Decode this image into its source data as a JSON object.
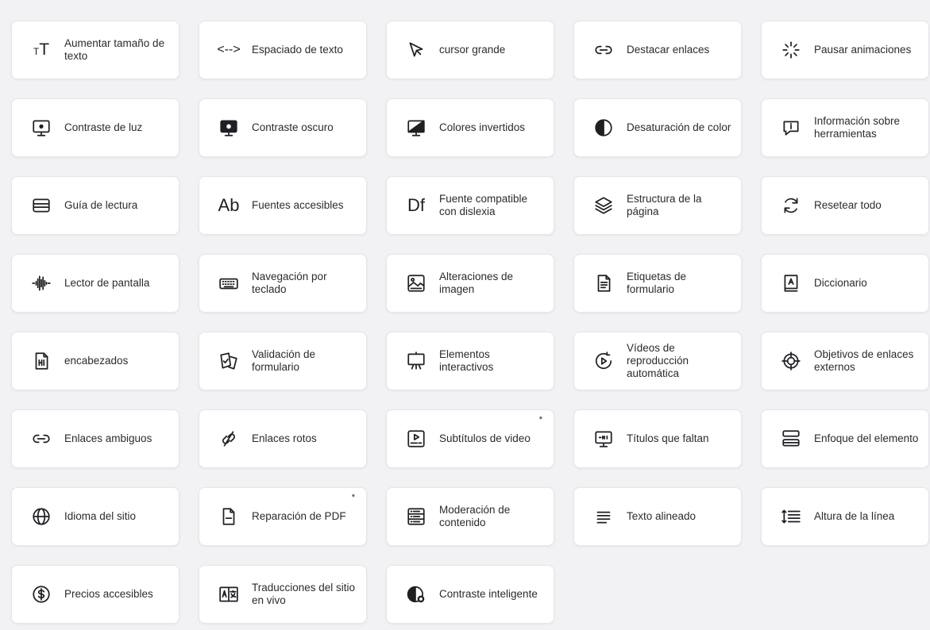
{
  "tools": [
    {
      "label": "Aumentar tamaño de texto",
      "icon": "text-size-icon",
      "glyph": "TT"
    },
    {
      "label": "Espaciado de texto",
      "icon": "text-spacing-icon",
      "glyph": "<-->"
    },
    {
      "label": "cursor grande",
      "icon": "cursor-icon"
    },
    {
      "label": "Destacar enlaces",
      "icon": "link-icon"
    },
    {
      "label": "Pausar animaciones",
      "icon": "loader-icon"
    },
    {
      "label": "Contraste de luz",
      "icon": "monitor-light-icon"
    },
    {
      "label": "Contraste oscuro",
      "icon": "monitor-dark-icon"
    },
    {
      "label": "Colores invertidos",
      "icon": "monitor-invert-icon"
    },
    {
      "label": "Desaturación de color",
      "icon": "half-circle-icon"
    },
    {
      "label": "Información sobre herramientas",
      "icon": "tooltip-icon"
    },
    {
      "label": "Guía de lectura",
      "icon": "reading-guide-icon"
    },
    {
      "label": "Fuentes accesibles",
      "icon": "font-icon",
      "glyph": "Ab"
    },
    {
      "label": "Fuente compatible con dislexia",
      "icon": "dyslexia-font-icon",
      "glyph": "Df"
    },
    {
      "label": "Estructura de la página",
      "icon": "layers-icon"
    },
    {
      "label": "Resetear todo",
      "icon": "reset-icon"
    },
    {
      "label": "Lector de pantalla",
      "icon": "soundwave-icon"
    },
    {
      "label": "Navegación por teclado",
      "icon": "keyboard-icon"
    },
    {
      "label": "Alteraciones de imagen",
      "icon": "image-icon"
    },
    {
      "label": "Etiquetas de formulario",
      "icon": "form-label-icon"
    },
    {
      "label": "Diccionario",
      "icon": "dictionary-icon"
    },
    {
      "label": "encabezados",
      "icon": "heading-file-icon"
    },
    {
      "label": "Validación de formulario",
      "icon": "form-validation-icon"
    },
    {
      "label": "Elementos interactivos",
      "icon": "easel-icon"
    },
    {
      "label": "Vídeos de reproducción automática",
      "icon": "autoplay-icon"
    },
    {
      "label": "Objetivos de enlaces externos",
      "icon": "target-icon"
    },
    {
      "label": "Enlaces ambiguos",
      "icon": "link-icon"
    },
    {
      "label": "Enlaces rotos",
      "icon": "broken-link-icon"
    },
    {
      "label": "Subtítulos de video",
      "icon": "video-captions-icon",
      "badge": "*"
    },
    {
      "label": "Títulos que faltan",
      "icon": "monitor-title-icon"
    },
    {
      "label": "Enfoque del elemento",
      "icon": "focus-icon"
    },
    {
      "label": "Idioma del sitio",
      "icon": "globe-icon"
    },
    {
      "label": "Reparación de PDF",
      "icon": "pdf-icon",
      "badge": "*"
    },
    {
      "label": "Moderación de contenido",
      "icon": "moderation-icon"
    },
    {
      "label": "Texto alineado",
      "icon": "align-icon"
    },
    {
      "label": "Altura de la línea",
      "icon": "line-height-icon"
    },
    {
      "label": "Precios accesibles",
      "icon": "dollar-icon"
    },
    {
      "label": "Traducciones del sitio en vivo",
      "icon": "translate-icon"
    },
    {
      "label": "Contraste inteligente",
      "icon": "smart-contrast-icon"
    }
  ]
}
